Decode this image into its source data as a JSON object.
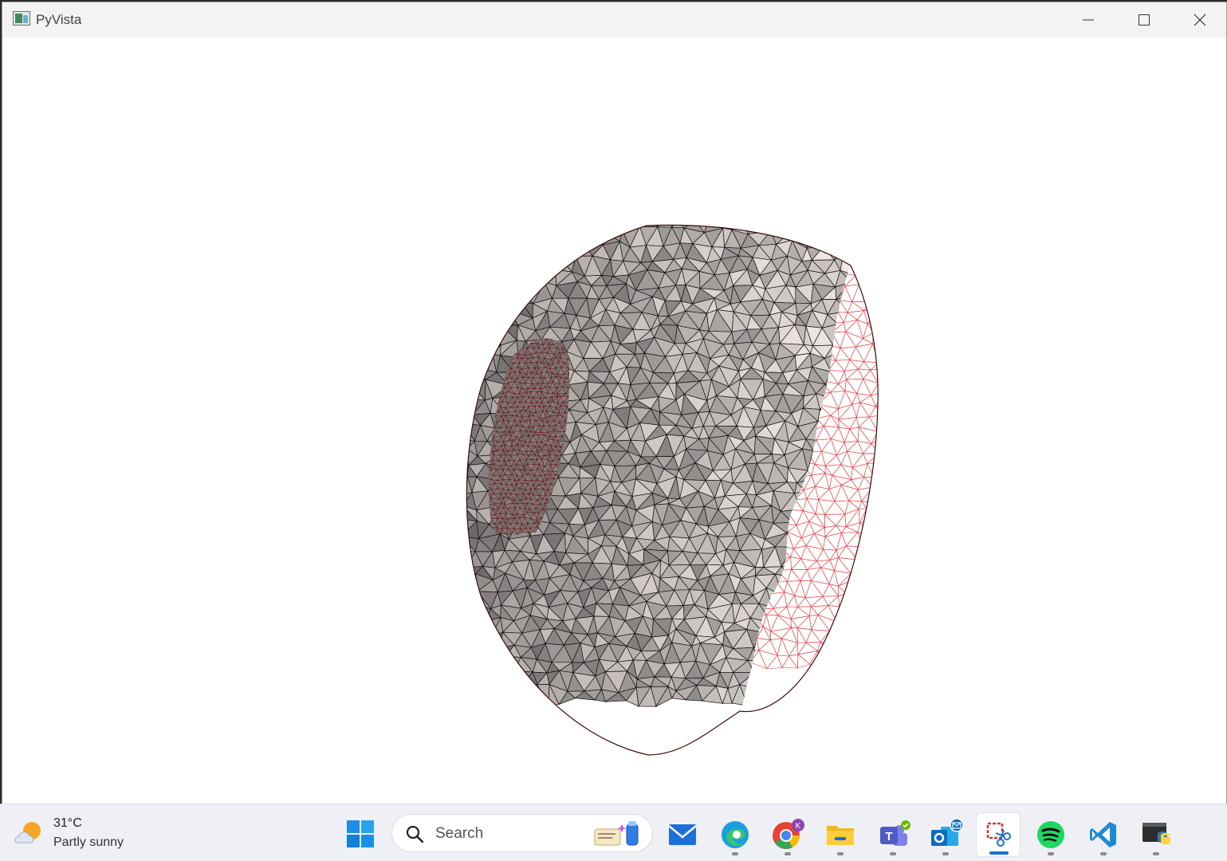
{
  "window": {
    "title": "PyVista",
    "controls": [
      "minimize-icon",
      "maximize-icon",
      "close-icon"
    ]
  },
  "viewport": {
    "render": "3D triangulated hemisphere mesh with partial clipping; black edges on shaded faces and red wireframe on clipped region",
    "colors": {
      "background": "#ffffff",
      "face_light": "#f2ebe6",
      "face_dark": "#5a5556",
      "edge": "#111111",
      "wire": "#e0454a"
    }
  },
  "taskbar": {
    "weather": {
      "temp": "31°C",
      "condition": "Partly sunny",
      "icon": "partly-sunny-icon"
    },
    "search": {
      "placeholder": "Search"
    },
    "apps": [
      {
        "name": "mail",
        "icon": "mail-icon"
      },
      {
        "name": "edge",
        "icon": "edge-icon",
        "running": true
      },
      {
        "name": "chrome",
        "icon": "chrome-icon",
        "running": true,
        "badge": "K"
      },
      {
        "name": "file-explorer",
        "icon": "folder-icon",
        "running": true
      },
      {
        "name": "teams",
        "icon": "teams-icon",
        "running": true
      },
      {
        "name": "outlook",
        "icon": "outlook-icon",
        "running": true
      },
      {
        "name": "snipping-tool",
        "icon": "snipping-tool-icon",
        "running": true,
        "active": true
      },
      {
        "name": "spotify",
        "icon": "spotify-icon",
        "running": true
      },
      {
        "name": "vscode",
        "icon": "vscode-icon",
        "running": true
      },
      {
        "name": "python",
        "icon": "python-icon",
        "running": true
      }
    ]
  }
}
